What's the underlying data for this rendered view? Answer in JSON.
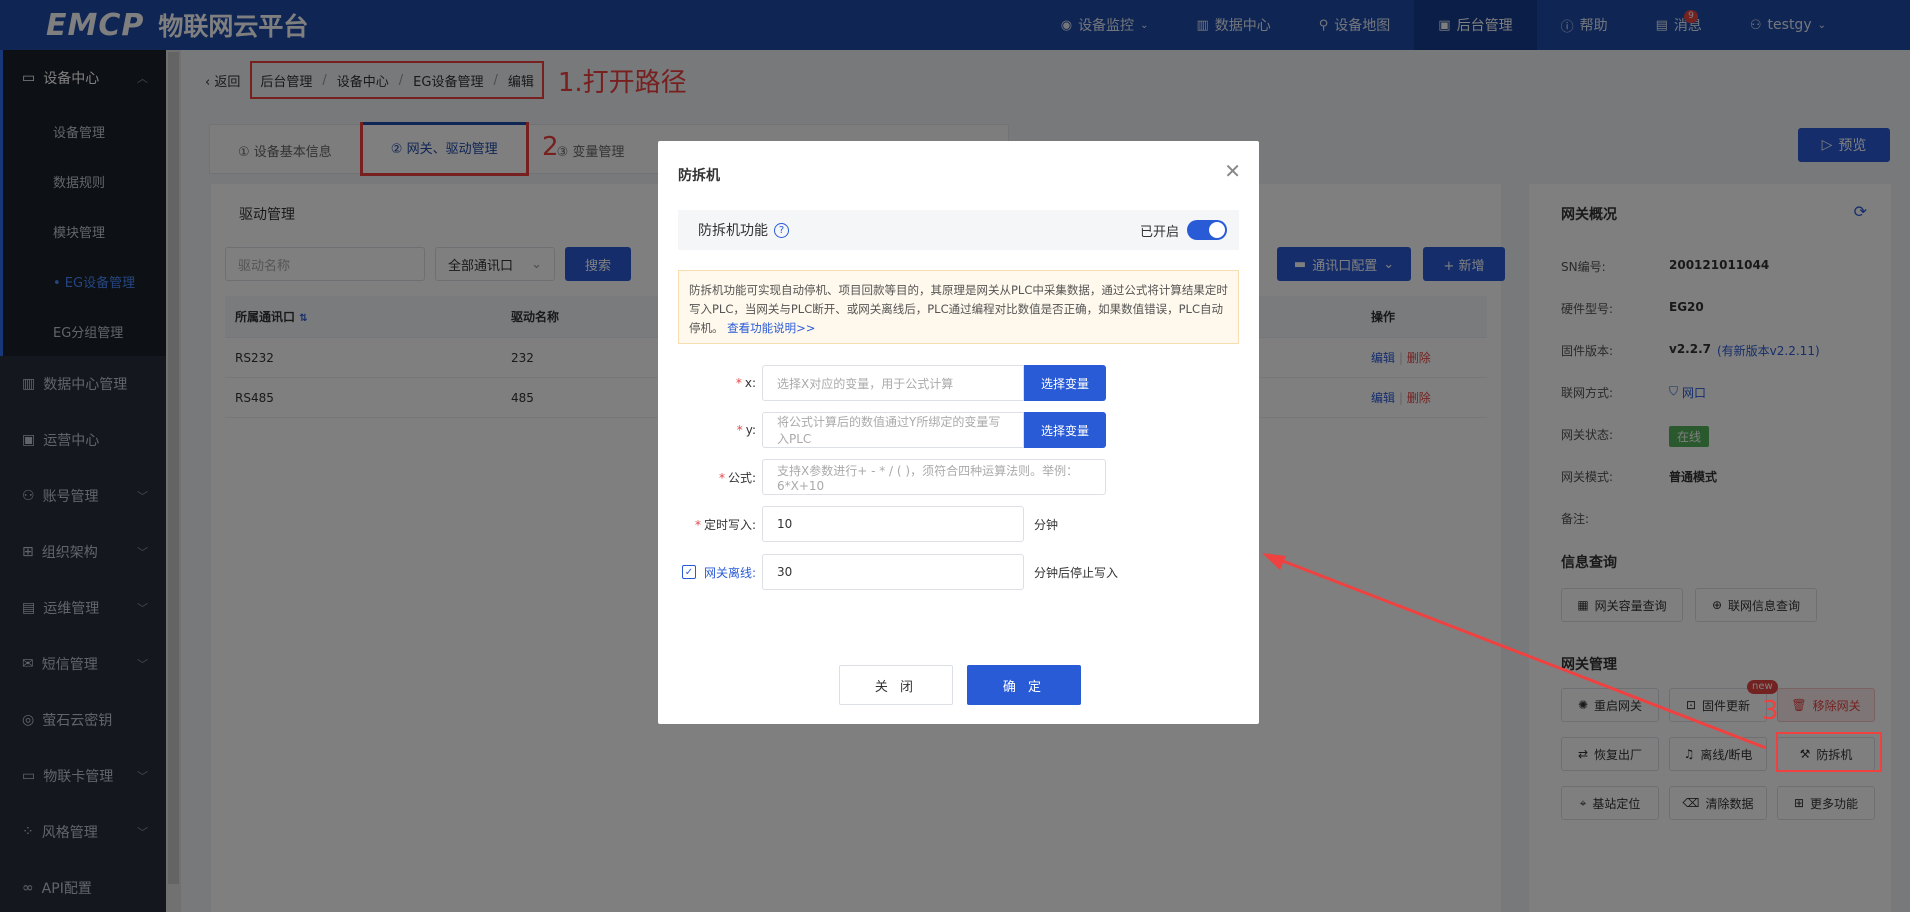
{
  "header": {
    "brand": "EMCP",
    "subtitle": "物联网云平台",
    "nav": [
      {
        "label": "设备监控",
        "icon": "monitor-icon",
        "chevron": true
      },
      {
        "label": "数据中心",
        "icon": "bar-chart-icon"
      },
      {
        "label": "设备地图",
        "icon": "map-pin-icon"
      },
      {
        "label": "后台管理",
        "icon": "admin-icon",
        "active": true
      },
      {
        "label": "帮助",
        "icon": "help-icon"
      },
      {
        "label": "消息",
        "icon": "message-icon",
        "badge": "9"
      },
      {
        "label": "testgy",
        "icon": "user-icon",
        "chevron": true
      }
    ]
  },
  "sidebar": {
    "groups": [
      {
        "label": "设备中心",
        "open": true
      },
      {
        "label": "数据中心管理"
      },
      {
        "label": "运营中心"
      },
      {
        "label": "账号管理"
      },
      {
        "label": "组织架构"
      },
      {
        "label": "运维管理"
      },
      {
        "label": "短信管理"
      },
      {
        "label": "萤石云密钥"
      },
      {
        "label": "物联卡管理"
      },
      {
        "label": "风格管理"
      },
      {
        "label": "API配置"
      }
    ],
    "sub_items": [
      "设备管理",
      "数据规则",
      "模块管理",
      "• EG设备管理",
      "EG分组管理"
    ]
  },
  "breadcrumb": {
    "back": "返回",
    "items": [
      "后台管理",
      "设备中心",
      "EG设备管理",
      "编辑"
    ],
    "annotation": "1.打开路径"
  },
  "tabs": {
    "items": [
      "① 设备基本信息",
      "② 网关、驱动管理",
      "③ 变量管理"
    ],
    "annotation": "2",
    "preview": "预览"
  },
  "driver": {
    "title": "驱动管理",
    "search_placeholder": "驱动名称",
    "port_select": "全部通讯口",
    "search_btn": "搜索",
    "port_config_btn": "通讯口配置",
    "add_btn": "+ 新增",
    "columns": [
      "所属通讯口",
      "驱动名称",
      "操作"
    ],
    "rows": [
      {
        "port": "RS232",
        "name": "232",
        "edit": "编辑",
        "del": "删除"
      },
      {
        "port": "RS485",
        "name": "485",
        "edit": "编辑",
        "del": "删除"
      }
    ]
  },
  "gateway": {
    "title": "网关概况",
    "info": [
      {
        "k": "SN编号:",
        "v": "200121011044"
      },
      {
        "k": "硬件型号:",
        "v": "EG20"
      },
      {
        "k": "固件版本:",
        "v": "v2.2.7",
        "extra": "(有新版本v2.2.11)"
      },
      {
        "k": "联网方式:",
        "v": "网口"
      },
      {
        "k": "网关状态:",
        "v": "在线"
      },
      {
        "k": "网关模式:",
        "v": "普通模式"
      },
      {
        "k": "备注:",
        "v": ""
      }
    ],
    "query_title": "信息查询",
    "query_btns": [
      "网关容量查询",
      "联网信息查询"
    ],
    "manage_title": "网关管理",
    "manage_btns": [
      "重启网关",
      "固件更新",
      "移除网关",
      "恢复出厂",
      "离线/断电",
      "防拆机",
      "基站定位",
      "清除数据",
      "更多功能"
    ],
    "new_badge": "new",
    "annotation": "3"
  },
  "modal": {
    "title": "防拆机",
    "toggle_label": "防拆机功能",
    "toggle_state": "已开启",
    "note": "防拆机功能可实现自动停机、项目回款等目的，其原理是网关从PLC中采集数据，通过公式将计算结果定时写入PLC，当网关与PLC断开、或网关离线后，PLC通过编程对比数值是否正确，如果数值错误，PLC自动停机。",
    "note_link": "查看功能说明>>",
    "fields": {
      "x_label": "x:",
      "x_placeholder": "选择X对应的变量，用于公式计算",
      "y_label": "y:",
      "y_placeholder": "将公式计算后的数值通过Y所绑定的变量写入PLC",
      "select_var": "选择变量",
      "formula_label": "公式:",
      "formula_placeholder": "支持X参数进行+ - * / ( )，须符合四种运算法则。举例：6*X+10",
      "timer_label": "定时写入:",
      "timer_value": "10",
      "timer_unit": "分钟",
      "offline_label": "网关离线:",
      "offline_value": "30",
      "offline_unit": "分钟后停止写入"
    },
    "cancel": "关 闭",
    "ok": "确 定"
  }
}
